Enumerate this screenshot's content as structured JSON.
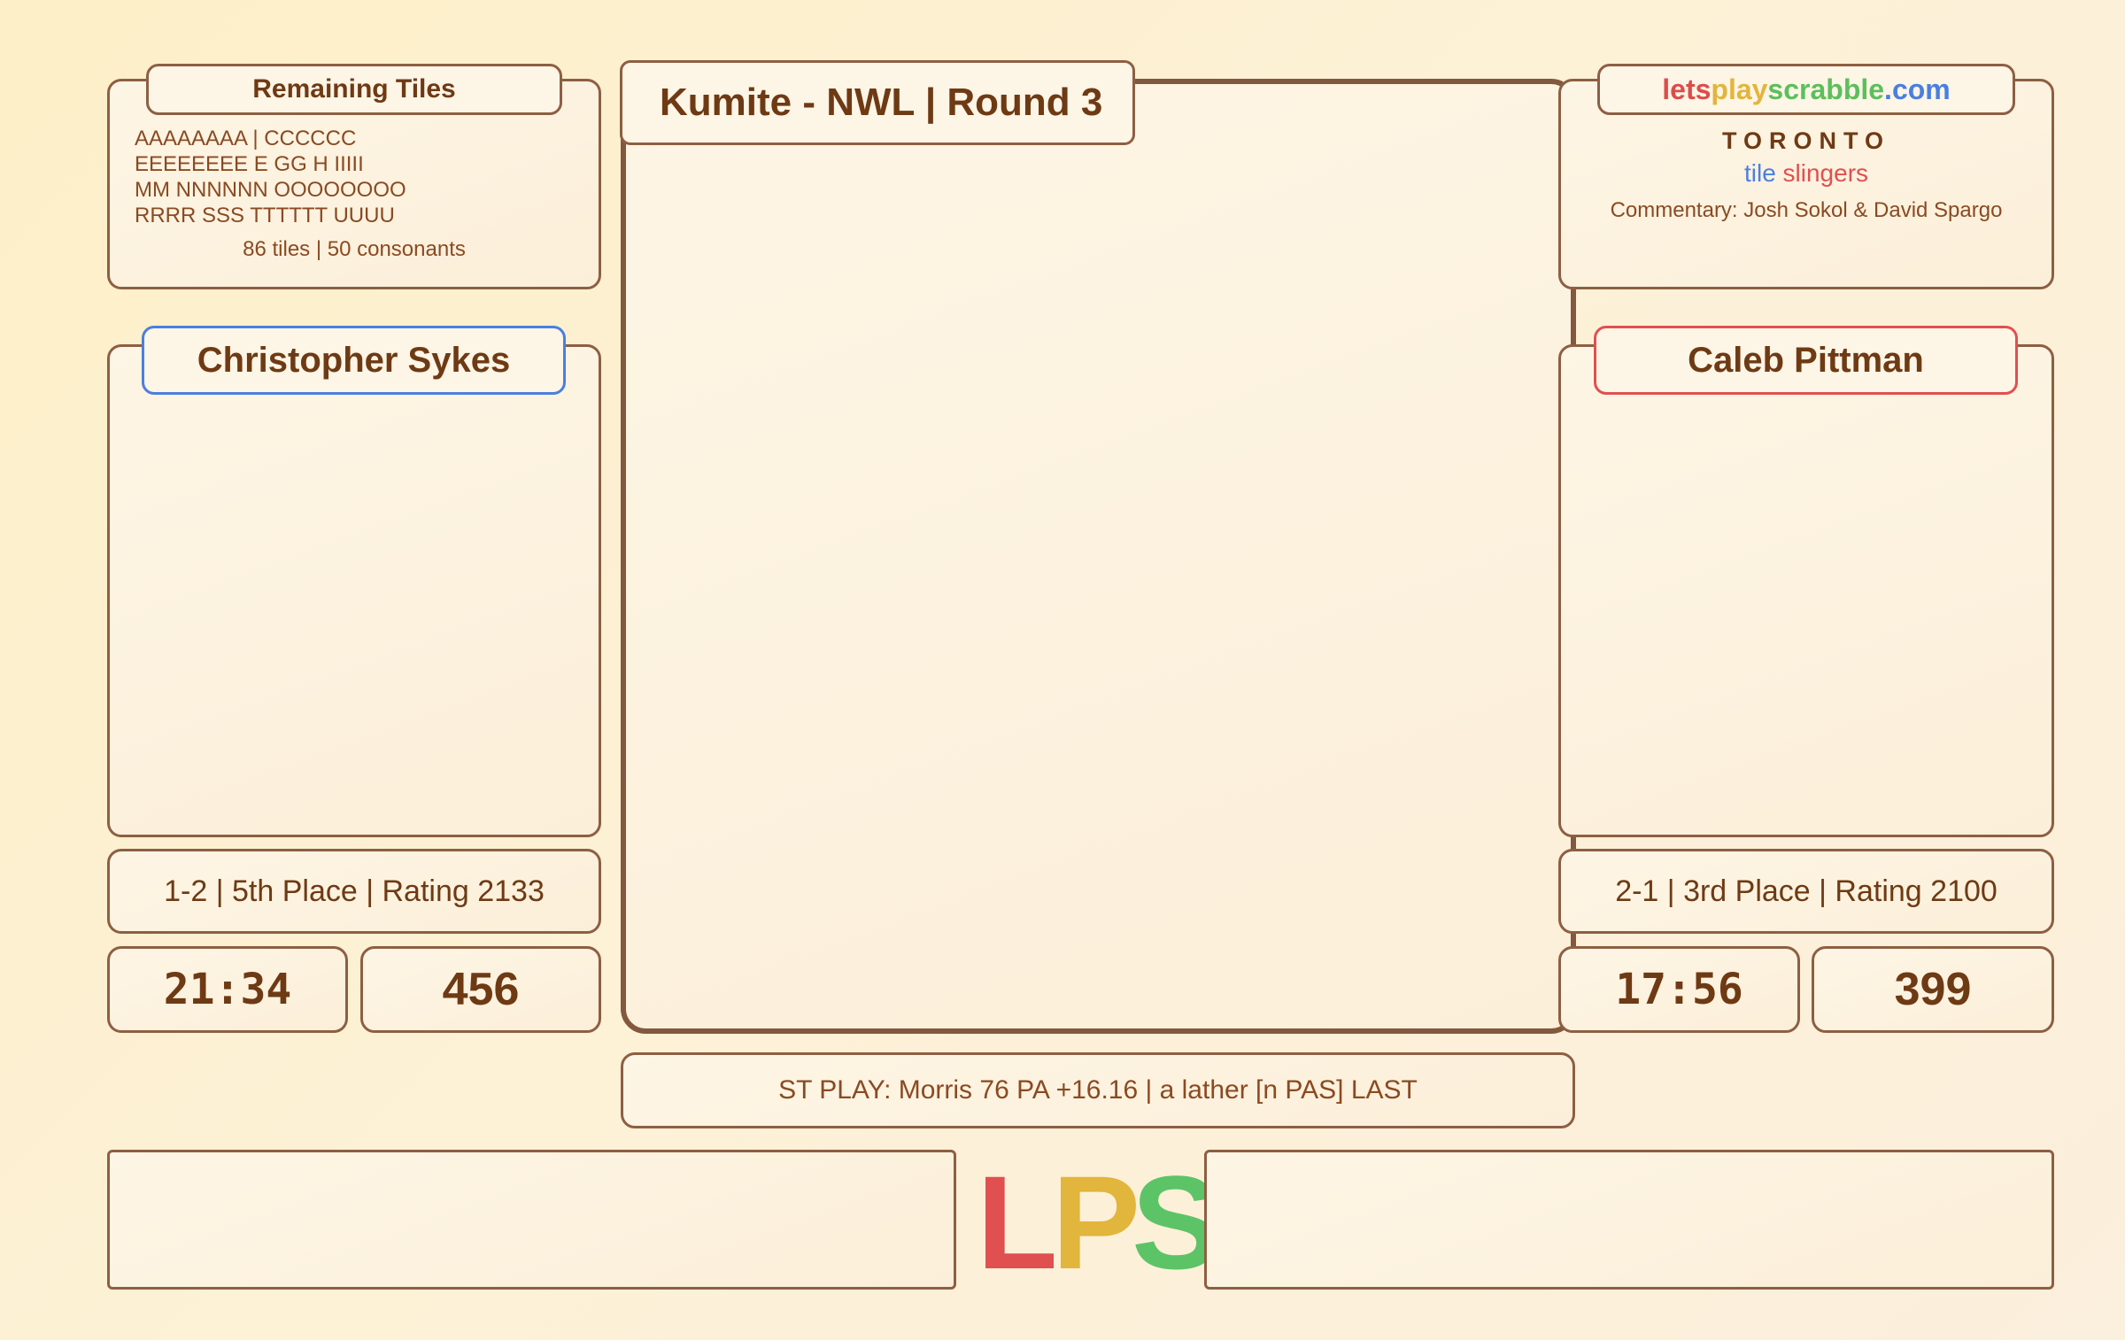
{
  "remaining_tiles": {
    "title": "Remaining Tiles",
    "lines": [
      "AAAAAAAA | CCCCCC",
      "EEEEEEEE E GG H IIIII",
      "MM NNNNNN OOOOOOOO",
      "RRRR SSS TTTTTT UUUU"
    ],
    "summary": "86 tiles | 50 consonants"
  },
  "board": {
    "title": "Kumite - NWL | Round 3"
  },
  "brand": {
    "site_parts": [
      {
        "text": "lets",
        "color": "#dc4d4a"
      },
      {
        "text": "play",
        "color": "#e2b53c"
      },
      {
        "text": "scrabble",
        "color": "#5cbf5c"
      },
      {
        "text": ".com",
        "color": "#4a7fe0"
      }
    ],
    "city": "TORONTO",
    "subtitle_word1": "tile",
    "subtitle_word2": "slingers",
    "commentary": "Commentary: Josh Sokol & David Spargo"
  },
  "player1": {
    "name": "Christopher Sykes",
    "record": "1-2 | 5th Place | Rating 2133",
    "clock": "21:34",
    "score": "456",
    "accent": "#4a7fe0"
  },
  "player2": {
    "name": "Caleb Pittman",
    "record": "2-1 | 3rd Place | Rating 2100",
    "clock": "17:56",
    "score": "399",
    "accent": "#e05050"
  },
  "ticker": "ST PLAY: Morris 76 PA +16.16 | a lather [n PAS] LAST",
  "logo": {
    "letters": [
      {
        "char": "L",
        "color": "#e05050"
      },
      {
        "char": "P",
        "color": "#e2b53c"
      },
      {
        "char": "S",
        "color": "#5cc466"
      }
    ]
  },
  "colors": {
    "text": "#6e3a14",
    "border": "#8d5f43",
    "background": "#fdefc7"
  }
}
